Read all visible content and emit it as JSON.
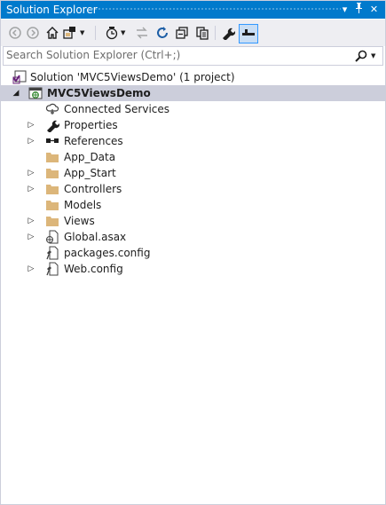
{
  "window": {
    "title": "Solution Explorer"
  },
  "title_buttons": {
    "dropdown": "▾",
    "pin": "†",
    "close": "✕"
  },
  "toolbar": {
    "back_icon": "back-circle-icon",
    "forward_icon": "forward-circle-icon",
    "home_icon": "home-icon",
    "switch_views_icon": "switch-views-icon",
    "pending_changes_icon": "history-clock-icon",
    "sync_icon": "sync-arrows-icon",
    "refresh_icon": "refresh-icon",
    "collapse_all_icon": "collapse-all-icon",
    "show_all_files_icon": "show-all-files-icon",
    "properties_icon": "wrench-icon",
    "preview_icon": "preview-selected-icon"
  },
  "search": {
    "placeholder": "Search Solution Explorer (Ctrl+;)",
    "value": ""
  },
  "tree": {
    "solution": "Solution 'MVC5ViewsDemo' (1 project)",
    "project": "MVC5ViewsDemo",
    "items": [
      {
        "label": "Connected Services",
        "icon": "connected-services-icon",
        "expandable": false
      },
      {
        "label": "Properties",
        "icon": "wrench-icon",
        "expandable": true
      },
      {
        "label": "References",
        "icon": "references-icon",
        "expandable": true
      },
      {
        "label": "App_Data",
        "icon": "folder-icon",
        "expandable": false
      },
      {
        "label": "App_Start",
        "icon": "folder-icon",
        "expandable": true
      },
      {
        "label": "Controllers",
        "icon": "folder-icon",
        "expandable": true
      },
      {
        "label": "Models",
        "icon": "folder-icon",
        "expandable": false
      },
      {
        "label": "Views",
        "icon": "folder-icon",
        "expandable": true
      },
      {
        "label": "Global.asax",
        "icon": "global-asax-icon",
        "expandable": true
      },
      {
        "label": "packages.config",
        "icon": "config-file-icon",
        "expandable": false
      },
      {
        "label": "Web.config",
        "icon": "config-file-icon",
        "expandable": true
      }
    ]
  },
  "colors": {
    "accent": "#007acc",
    "toolbar_bg": "#eeeef2",
    "selected_row": "#cccedb",
    "folder": "#dcb67a"
  }
}
